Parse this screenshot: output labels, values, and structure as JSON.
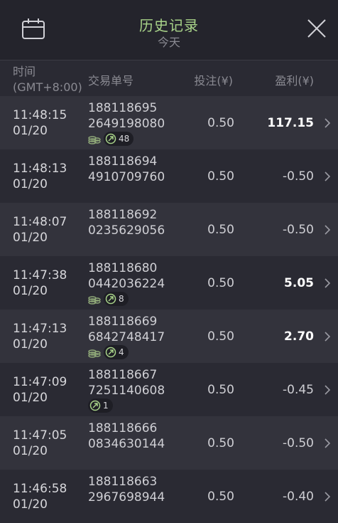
{
  "header": {
    "title": "历史记录",
    "subtitle": "今天"
  },
  "columns": {
    "time": "时间",
    "timezone": "(GMT+8:00)",
    "order": "交易单号",
    "bet": "投注(¥)",
    "profit": "盈利(¥)"
  },
  "rows": [
    {
      "time": "11:48:15",
      "date": "01/20",
      "order1": "188118695",
      "order2": "2649198080",
      "bet": "0.50",
      "profit": "117.15",
      "coin": true,
      "count": "48"
    },
    {
      "time": "11:48:13",
      "date": "01/20",
      "order1": "188118694",
      "order2": "4910709760",
      "bet": "0.50",
      "profit": "-0.50"
    },
    {
      "time": "11:48:07",
      "date": "01/20",
      "order1": "188118692",
      "order2": "0235629056",
      "bet": "0.50",
      "profit": "-0.50"
    },
    {
      "time": "11:47:38",
      "date": "01/20",
      "order1": "188118680",
      "order2": "0442036224",
      "bet": "0.50",
      "profit": "5.05",
      "coin": true,
      "count": "8"
    },
    {
      "time": "11:47:13",
      "date": "01/20",
      "order1": "188118669",
      "order2": "6842748417",
      "bet": "0.50",
      "profit": "2.70",
      "coin": true,
      "count": "4"
    },
    {
      "time": "11:47:09",
      "date": "01/20",
      "order1": "188118667",
      "order2": "7251140608",
      "bet": "0.50",
      "profit": "-0.45",
      "count": "1"
    },
    {
      "time": "11:47:05",
      "date": "01/20",
      "order1": "188118666",
      "order2": "0834630144",
      "bet": "0.50",
      "profit": "-0.50"
    },
    {
      "time": "11:46:58",
      "date": "01/20",
      "order1": "188118663",
      "order2": "2967698944",
      "bet": "0.50",
      "profit": "-0.40"
    }
  ],
  "icons": {
    "calendar": "calendar-icon",
    "close": "close-icon",
    "chevron": "chevron-right-icon",
    "coin": "coins-icon",
    "free_spin": "free-spin-icon"
  },
  "colors": {
    "accent": "#a8d389",
    "background": "#2a2a33"
  }
}
